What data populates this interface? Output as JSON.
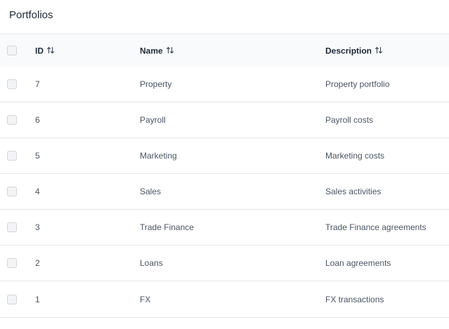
{
  "page": {
    "title": "Portfolios"
  },
  "table": {
    "columns": [
      {
        "label": "ID",
        "sort_icon": "sort-arrows-icon"
      },
      {
        "label": "Name",
        "sort_icon": "sort-arrows-icon"
      },
      {
        "label": "Description",
        "sort_icon": "sort-arrows-icon"
      }
    ],
    "rows": [
      {
        "id": "7",
        "name": "Property",
        "description": "Property portfolio"
      },
      {
        "id": "6",
        "name": "Payroll",
        "description": "Payroll costs"
      },
      {
        "id": "5",
        "name": "Marketing",
        "description": "Marketing costs"
      },
      {
        "id": "4",
        "name": "Sales",
        "description": "Sales activities"
      },
      {
        "id": "3",
        "name": "Trade Finance",
        "description": "Trade Finance agreements"
      },
      {
        "id": "2",
        "name": "Loans",
        "description": "Loan agreements"
      },
      {
        "id": "1",
        "name": "FX",
        "description": "FX transactions"
      }
    ]
  },
  "colors": {
    "border": "#e5e7eb",
    "header_bg": "#f9fafb",
    "text": "#4b5563",
    "heading": "#1f2937"
  }
}
